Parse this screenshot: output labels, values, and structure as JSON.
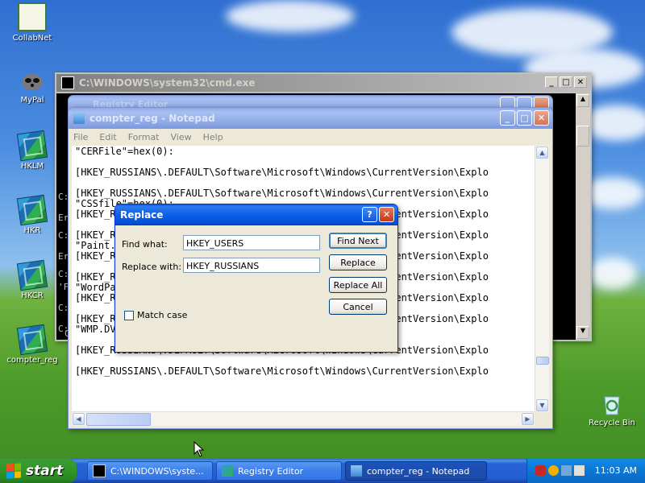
{
  "desktop": {
    "icons": [
      {
        "label": "CollabNet"
      },
      {
        "label": "MyPal"
      },
      {
        "label": "HKLM"
      },
      {
        "label": "HKR"
      },
      {
        "label": "HKCR"
      },
      {
        "label": "compter_reg"
      },
      {
        "label": "Recycle Bin"
      }
    ]
  },
  "cmd_window": {
    "title": "C:\\WINDOWS\\system32\\cmd.exe",
    "behind_title": "Registry Editor",
    "visible_chars": [
      "C:",
      "Er",
      "C:",
      "Er",
      "C:",
      "'F",
      "C:",
      "C:",
      "C:"
    ]
  },
  "notepad": {
    "title": "compter_reg - Notepad",
    "menu": [
      "File",
      "Edit",
      "Format",
      "View",
      "Help"
    ],
    "lines": [
      "\"CERFile\"=hex(0):",
      "",
      "[HKEY_RUSSIANS\\.DEFAULT\\Software\\Microsoft\\Windows\\CurrentVersion\\Explo",
      "",
      "[HKEY_RUSSIANS\\.DEFAULT\\Software\\Microsoft\\Windows\\CurrentVersion\\Explo",
      "\"CSSfile\"=hex(0):",
      "[HKEY_RUSSIANS\\.DEFAULT\\Software\\Microsoft\\Windows\\CurrentVersion\\Explo",
      "",
      "[HKEY_RUSSIANS\\.DEFAULT\\Software\\Microsoft\\Windows\\CurrentVersion\\Explo",
      "\"Paint.Picture\"=hex(0):",
      "[HKEY_RUSSIANS\\.DEFAULT\\Software\\Microsoft\\Windows\\CurrentVersion\\Explo",
      "",
      "[HKEY_RUSSIANS\\.DEFAULT\\Software\\Microsoft\\Windows\\CurrentVersion\\Explo",
      "\"WordPad.Document.1\"=hex(0):",
      "[HKEY_RUSSIANS\\.DEFAULT\\Software\\Microsoft\\Windows\\CurrentVersion\\Explo",
      "",
      "[HKEY_RUSSIANS\\.DEFAULT\\Software\\Microsoft\\Windows\\CurrentVersion\\Explo",
      "\"WMP.DVR-MSFile\"=hex(0):",
      "",
      "[HKEY_RUSSIANS\\.DEFAULT\\Software\\Microsoft\\Windows\\CurrentVersion\\Explo",
      "",
      "[HKEY_RUSSIANS\\.DEFAULT\\Software\\Microsoft\\Windows\\CurrentVersion\\Explo"
    ]
  },
  "replace_dialog": {
    "title": "Replace",
    "find_label": "Find what:",
    "find_value": "HKEY_USERS",
    "replace_label": "Replace with:",
    "replace_value": "HKEY_RUSSIANS",
    "match_case_label": "Match case",
    "match_case_checked": false,
    "buttons": {
      "find_next": "Find Next",
      "replace": "Replace",
      "replace_all": "Replace All",
      "cancel": "Cancel"
    }
  },
  "taskbar": {
    "start_label": "start",
    "tasks": [
      {
        "label": "C:\\WINDOWS\\syste..."
      },
      {
        "label": "Registry Editor"
      },
      {
        "label": "compter_reg - Notepad"
      }
    ],
    "clock": "11:03 AM"
  },
  "colors": {
    "xp_blue": "#0a5ae0",
    "start_green": "#379b2e",
    "desktop_sky": "#4b8de0",
    "desktop_grass": "#4d9b2a"
  }
}
